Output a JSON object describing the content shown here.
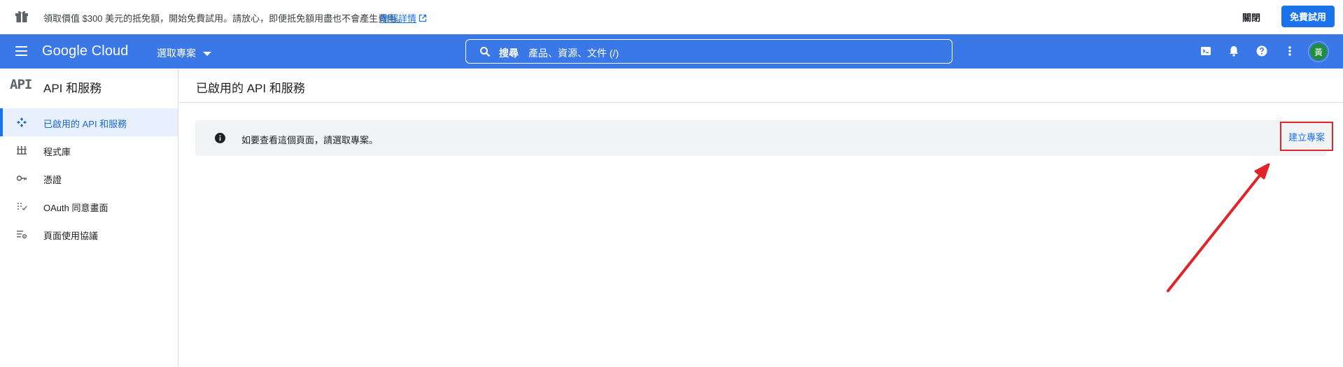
{
  "promo": {
    "icon": "gift-icon",
    "message": "領取價值 $300 美元的抵免額，開始免費試用。請放心，即便抵免額用盡也不會產生費用。",
    "learn_more": "瞭解詳情",
    "dismiss_label": "關閉",
    "trial_button": "免費試用"
  },
  "header": {
    "logo": "Google Cloud",
    "project_selector": "選取專案",
    "search_label": "搜尋",
    "search_placeholder": "產品、資源、文件 (/)",
    "avatar_initial": "黃",
    "icons": [
      "cloud-shell-icon",
      "notifications-icon",
      "help-icon",
      "more-vert-icon"
    ]
  },
  "sidebar": {
    "logo_text": "API",
    "title": "API 和服務",
    "items": [
      {
        "label": "已啟用的 API 和服務",
        "icon": "api-diamond-icon",
        "active": true
      },
      {
        "label": "程式庫",
        "icon": "library-icon",
        "active": false
      },
      {
        "label": "憑證",
        "icon": "key-icon",
        "active": false
      },
      {
        "label": "OAuth 同意畫面",
        "icon": "consent-icon",
        "active": false
      },
      {
        "label": "頁面使用協議",
        "icon": "page-settings-icon",
        "active": false
      }
    ]
  },
  "main": {
    "title": "已啟用的 API 和服務",
    "notice_text": "如要查看這個頁面，請選取專案。",
    "create_project": "建立專案"
  },
  "colors": {
    "header_blue": "#3b78e7",
    "accent": "#1a73e8",
    "annotation_red": "#e0242b"
  }
}
